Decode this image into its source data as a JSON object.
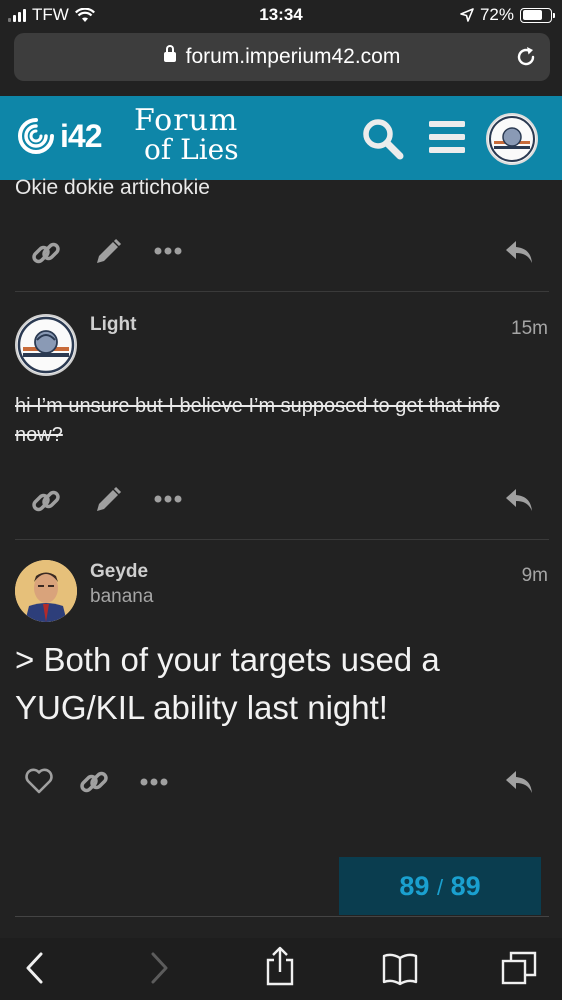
{
  "status_bar": {
    "carrier": "TFW",
    "time": "13:34",
    "battery": "72%",
    "battery_level": 0.72
  },
  "browser": {
    "url": "forum.imperium42.com",
    "icons": [
      "lock-icon",
      "reload-icon",
      "back-icon",
      "forward-icon",
      "share-icon",
      "bookmarks-icon",
      "tabs-icon"
    ]
  },
  "header": {
    "brand_short": "i42",
    "forum_title_line1": "Forum",
    "forum_title_line2": "of Lies",
    "accent_color": "#0e86a8"
  },
  "posts": [
    {
      "body": "Okie dokie artichokie"
    },
    {
      "username": "Light",
      "time": "15m",
      "body_strikethrough": "hi I’m unsure but I believe I’m supposed to get that info now?"
    },
    {
      "username": "Geyde",
      "user_title": "banana",
      "time": "9m",
      "body": "> Both of your targets used a YUG/KIL ability last night!"
    }
  ],
  "progress": {
    "current": "89",
    "separator": "/",
    "total": "89"
  }
}
